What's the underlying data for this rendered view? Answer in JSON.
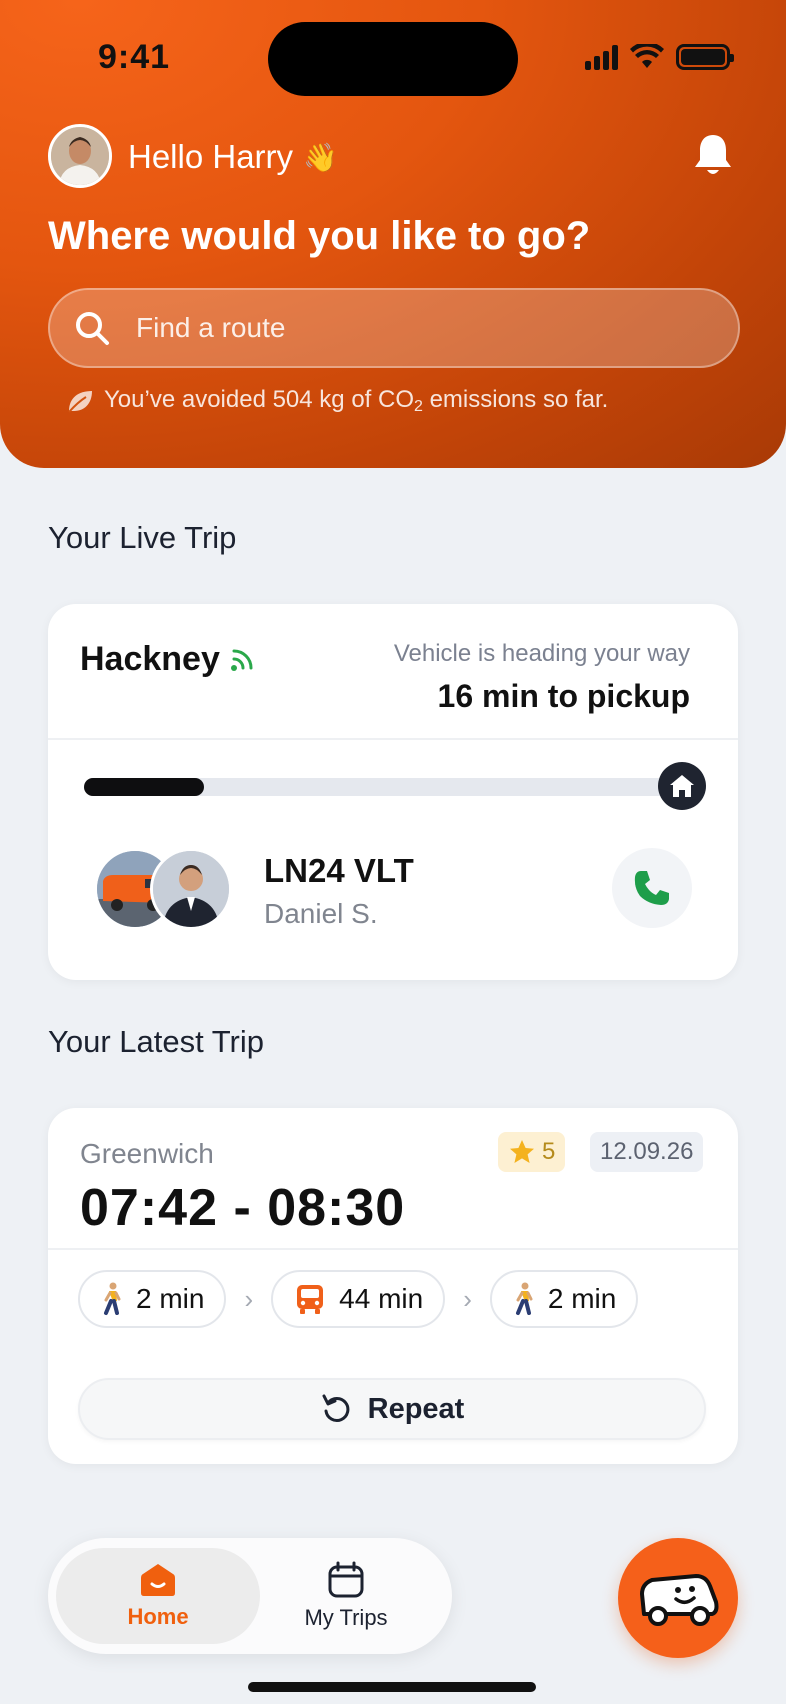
{
  "status_bar": {
    "time": "9:41"
  },
  "header": {
    "greeting": "Hello Harry",
    "greeting_emoji": "👋",
    "title": "Where would you like to go?",
    "search_placeholder": "Find a route",
    "eco_prefix": "You’ve avoided 504 kg of CO",
    "eco_sub": "2",
    "eco_suffix": " emissions so far."
  },
  "live_trip": {
    "section_title": "Your Live Trip",
    "destination": "Hackney",
    "status": "Vehicle is heading your way",
    "eta": "16 min to pickup",
    "progress": 0.2,
    "plate": "LN24 VLT",
    "driver": "Daniel S."
  },
  "latest_trip": {
    "section_title": "Your Latest Trip",
    "destination": "Greenwich",
    "time_range": "07:42 - 08:30",
    "rating": "5",
    "date": "12.09.26",
    "legs": [
      {
        "icon": "walk-icon",
        "label": "2 min"
      },
      {
        "icon": "bus-icon",
        "label": "44 min"
      },
      {
        "icon": "walk-icon",
        "label": "2 min"
      }
    ],
    "repeat_label": "Repeat"
  },
  "tabbar": {
    "home_label": "Home",
    "trips_label": "My Trips"
  },
  "colors": {
    "brand": "#f5601a",
    "call_green": "#1e9e4a",
    "signal_green": "#2aa84a"
  }
}
